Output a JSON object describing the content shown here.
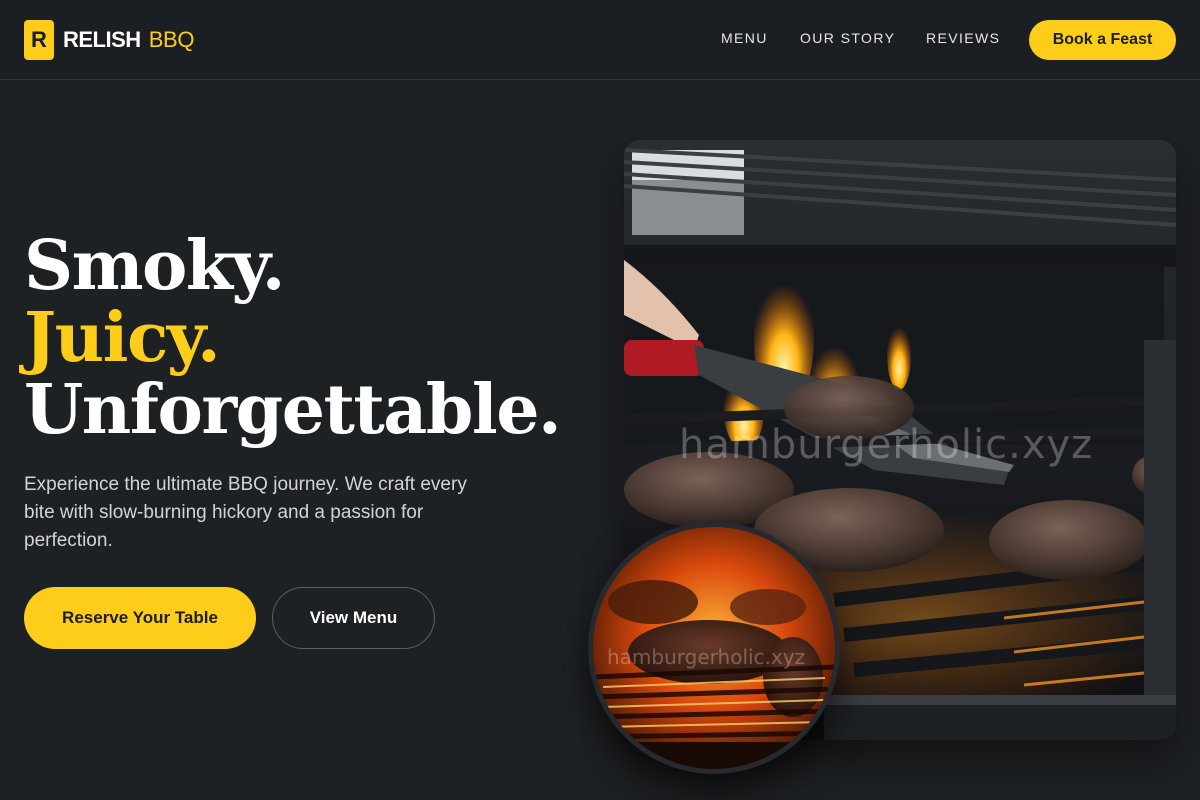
{
  "brand": {
    "mark": "R",
    "name": "RELISH",
    "accent": "BBQ",
    "accent_color": "#fdcd1a"
  },
  "nav": {
    "links": [
      {
        "label": "MENU"
      },
      {
        "label": "OUR STORY"
      },
      {
        "label": "REVIEWS"
      }
    ],
    "cta_label": "Book a Feast"
  },
  "hero": {
    "headline_line1": "Smoky.",
    "headline_line2": "Juicy.",
    "headline_line3": "Unforgettable.",
    "description": "Experience the ultimate BBQ journey. We craft every bite with slow-burning hickory and a passion for perfection.",
    "primary_button": "Reserve Your Table",
    "secondary_button": "View Menu"
  },
  "images": {
    "main_photo": "grill-burgers-photo",
    "main_watermark": "hamburgerholic.xyz",
    "circle_photo": "flame-grilled-meat-photo",
    "circle_watermark": "hamburgerholic.xyz"
  },
  "colors": {
    "background": "#1e2124",
    "accent": "#fdcd1a",
    "text": "#ffffff"
  }
}
